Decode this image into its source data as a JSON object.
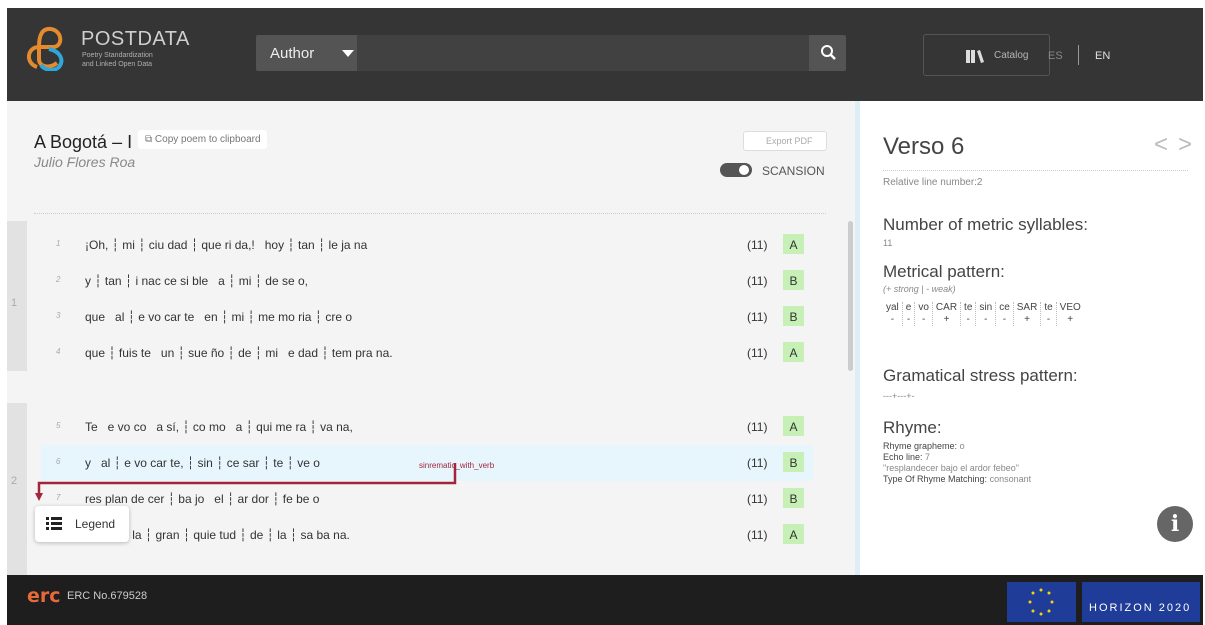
{
  "header": {
    "brand": "POSTDATA",
    "brand_sub1": "Poetry Standardization",
    "brand_sub2": "and Linked Open Data",
    "search_select": "Author",
    "search_placeholder": "",
    "catalog_label": "Catalog",
    "lang_es": "ES",
    "lang_en": "EN"
  },
  "poem": {
    "title": "A Bogotá – I",
    "copy_label": "Copy poem to clipboard",
    "author": "Julio Flores Roa",
    "export_label": "Export PDF",
    "scansion_label": "SCANSION",
    "scansion_on": true
  },
  "stanzas": [
    {
      "num": "1"
    },
    {
      "num": "2"
    }
  ],
  "lines": [
    {
      "num": "1",
      "text": "¡Oh, ┆ mi ┆ ciu dad ┆ que ri da,!   hoy ┆ tan ┆ le ja na",
      "count": "(11)",
      "rhyme": "A"
    },
    {
      "num": "2",
      "text": "y ┆ tan ┆ i nac ce si ble   a ┆ mi ┆ de se o,",
      "count": "(11)",
      "rhyme": "B"
    },
    {
      "num": "3",
      "text": "que   al ┆ e vo car te   en ┆ mi ┆ me mo ria ┆ cre o",
      "count": "(11)",
      "rhyme": "B"
    },
    {
      "num": "4",
      "text": "que ┆ fuis te   un ┆ sue ño ┆ de ┆ mi   e dad ┆ tem pra na.",
      "count": "(11)",
      "rhyme": "A"
    },
    {
      "num": "5",
      "text": "Te   e vo co   a sí, ┆ co mo   a ┆ qui me ra ┆ va na,",
      "count": "(11)",
      "rhyme": "A"
    },
    {
      "num": "6",
      "text": "y   al ┆ e vo car te, ┆ sin ┆ ce sar ┆ te ┆ ve o",
      "count": "(11)",
      "rhyme": "B",
      "tag": "sinrematic_with_verb"
    },
    {
      "num": "7",
      "text": "res plan de cer ┆ ba jo   el ┆ ar dor ┆ fe be o",
      "count": "(11)",
      "rhyme": "B"
    },
    {
      "num": "8",
      "text": "so bre ┆ la ┆ gran ┆ quie tud ┆ de ┆ la ┆ sa ba na.",
      "count": "(11)",
      "rhyme": "A"
    }
  ],
  "legend_label": "Legend",
  "verse": {
    "title": "Verso 6",
    "relative_label": "Relative line number:2",
    "syllables_heading": "Number of metric syllables:",
    "syllables_value": "11",
    "pattern_heading": "Metrical pattern:",
    "pattern_hint": "(+ strong | - weak)",
    "pattern": [
      {
        "s": "yal",
        "m": "-"
      },
      {
        "s": "e",
        "m": "-"
      },
      {
        "s": "vo",
        "m": "-"
      },
      {
        "s": "CAR",
        "m": "+"
      },
      {
        "s": "te",
        "m": "-"
      },
      {
        "s": "sin",
        "m": "-"
      },
      {
        "s": "ce",
        "m": "-"
      },
      {
        "s": "SAR",
        "m": "+"
      },
      {
        "s": "te",
        "m": "-"
      },
      {
        "s": "VEO",
        "m": "+"
      }
    ],
    "stress_heading": "Gramatical stress pattern:",
    "stress_value": "---+---+-",
    "rhyme_heading": "Rhyme:",
    "rhyme_grapheme_label": "Rhyme grapheme:",
    "rhyme_grapheme": "o",
    "echo_label": "Echo line:",
    "echo_value": "7",
    "echo_text": "\"resplandecer bajo el ardor febeo\"",
    "type_label": "Type Of Rhyme Matching:",
    "type_value": "consonant",
    "info": "i"
  },
  "footer": {
    "erc": "erc",
    "erc_no": "ERC No.679528",
    "horizon": "HORIZON 2020"
  },
  "colors": {
    "header": "#353535",
    "accent_blue": "#2fa7d8",
    "rhyme_green": "#c6f0b6",
    "link_red": "#a3253c"
  }
}
